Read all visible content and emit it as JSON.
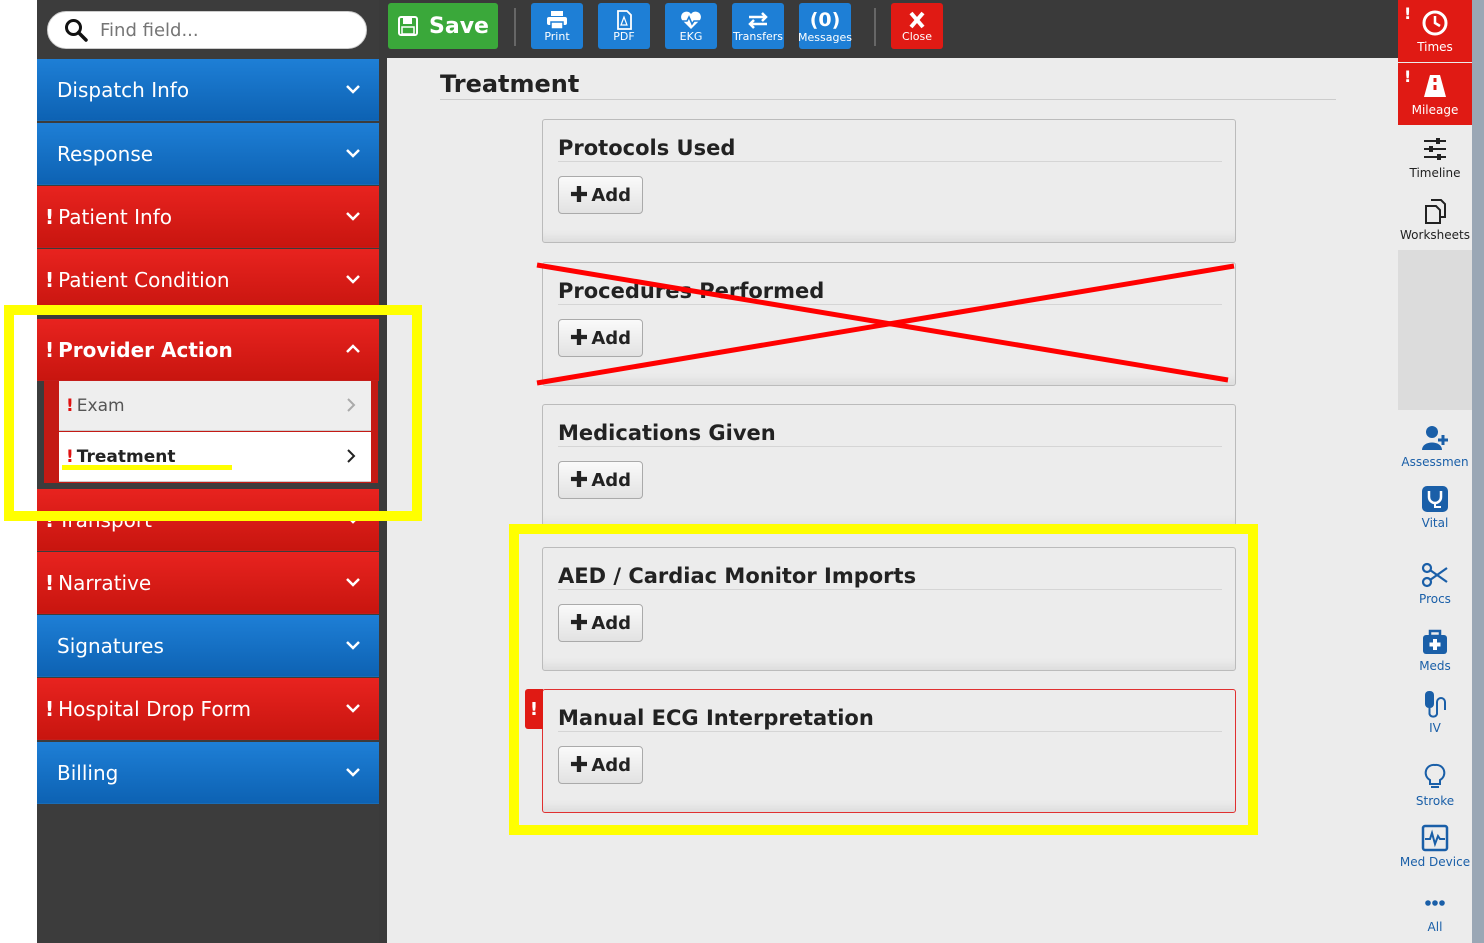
{
  "search": {
    "placeholder": "Find field..."
  },
  "toolbar": {
    "save_label": "Save",
    "print_label": "Print",
    "pdf_label": "PDF",
    "ekg_label": "EKG",
    "transfers_label": "Transfers",
    "messages_count": "(0)",
    "messages_label": "Messages",
    "close_label": "Close"
  },
  "sidebar": {
    "items": [
      {
        "label": "Dispatch Info",
        "color": "blue",
        "warning": false
      },
      {
        "label": "Response",
        "color": "blue",
        "warning": false
      },
      {
        "label": "Patient Info",
        "color": "red",
        "warning": true
      },
      {
        "label": "Patient Condition",
        "color": "red",
        "warning": true
      },
      {
        "label": "Provider Action",
        "color": "red",
        "warning": true,
        "expanded": true
      },
      {
        "label": "Transport",
        "color": "red",
        "warning": true
      },
      {
        "label": "Narrative",
        "color": "red",
        "warning": true
      },
      {
        "label": "Signatures",
        "color": "blue",
        "warning": false
      },
      {
        "label": "Hospital Drop Form",
        "color": "red",
        "warning": true
      },
      {
        "label": "Billing",
        "color": "blue",
        "warning": false
      }
    ],
    "sub_items": [
      {
        "label": "Exam",
        "warning": true,
        "selected": false
      },
      {
        "label": "Treatment",
        "warning": true,
        "selected": true
      }
    ],
    "warning_mark": "!"
  },
  "main": {
    "title": "Treatment",
    "panels": [
      {
        "title": "Protocols Used",
        "add_label": "Add",
        "warning": false
      },
      {
        "title": "Procedures Performed",
        "add_label": "Add",
        "warning": false,
        "crossed_out": true
      },
      {
        "title": "Medications Given",
        "add_label": "Add",
        "warning": false
      },
      {
        "title": "AED / Cardiac Monitor Imports",
        "add_label": "Add",
        "warning": false,
        "highlighted": true
      },
      {
        "title": "Manual ECG Interpretation",
        "add_label": "Add",
        "warning": true,
        "highlighted": true
      }
    ]
  },
  "rightbar": {
    "items": [
      {
        "label": "Times",
        "icon": "clock-icon",
        "warning": true
      },
      {
        "label": "Mileage",
        "icon": "road-icon",
        "warning": true
      },
      {
        "label": "Timeline",
        "icon": "sliders-icon",
        "warning": false
      },
      {
        "label": "Worksheets",
        "icon": "copy-icon",
        "warning": false
      },
      {
        "label": "Assessmen",
        "icon": "user-plus-icon",
        "warning": false
      },
      {
        "label": "Vital",
        "icon": "stethoscope-icon",
        "warning": false
      },
      {
        "label": "Procs",
        "icon": "scissors-icon",
        "warning": false
      },
      {
        "label": "Meds",
        "icon": "medkit-icon",
        "warning": false
      },
      {
        "label": "IV",
        "icon": "iv-icon",
        "warning": false
      },
      {
        "label": "Stroke",
        "icon": "lightbulb-icon",
        "warning": false
      },
      {
        "label": "Med Device",
        "icon": "monitor-icon",
        "warning": false
      },
      {
        "label": "All",
        "icon": "ellipsis-icon",
        "warning": false
      }
    ]
  },
  "colors": {
    "nav_blue": "#1e7fd6",
    "nav_red": "#e8231f",
    "save_green": "#3aa83a",
    "highlight": "#ffff00",
    "strike": "#ff0000"
  }
}
